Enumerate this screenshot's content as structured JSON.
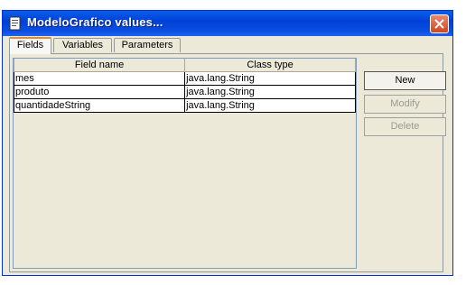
{
  "window": {
    "title": "ModeloGrafico values...",
    "accent": "#0a4fe0",
    "close_color": "#d2461e"
  },
  "tabs": [
    {
      "label": "Fields",
      "active": true
    },
    {
      "label": "Variables",
      "active": false
    },
    {
      "label": "Parameters",
      "active": false
    }
  ],
  "table": {
    "columns": [
      "Field name",
      "Class type"
    ],
    "rows": [
      [
        "mes",
        "java.lang.String"
      ],
      [
        "produto",
        "java.lang.String"
      ],
      [
        "quantidadeString",
        "java.lang.String"
      ]
    ]
  },
  "buttons": {
    "new_label": "New",
    "modify_label": "Modify",
    "delete_label": "Delete"
  },
  "icons": {
    "window_icon": "document-icon",
    "close_icon": "close-icon"
  }
}
